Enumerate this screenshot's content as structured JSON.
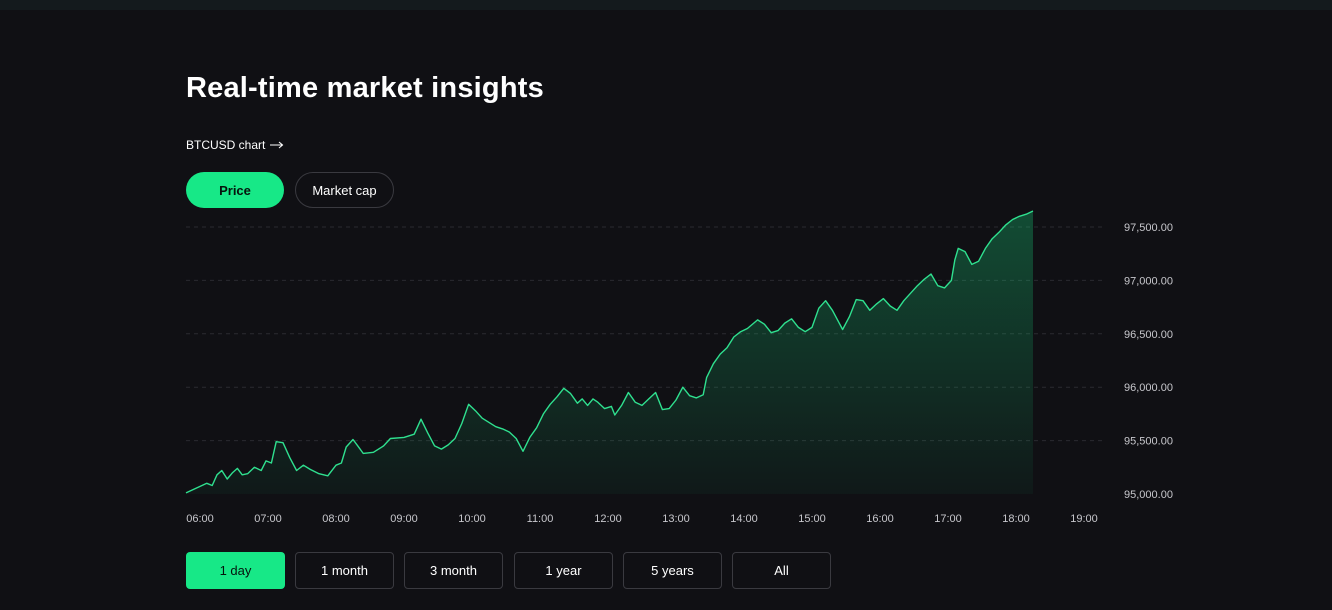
{
  "header": {
    "title": "Real-time market insights",
    "chart_link": "BTCUSD chart"
  },
  "toggle": {
    "price": "Price",
    "market_cap": "Market cap",
    "active": "price"
  },
  "ranges": {
    "items": [
      "1 day",
      "1 month",
      "3 month",
      "1 year",
      "5 years",
      "All"
    ],
    "active": "1 day"
  },
  "colors": {
    "accent": "#17e887",
    "background": "#101014",
    "line": "#2fe08f",
    "grid": "#2a2a30"
  },
  "chart_data": {
    "type": "area",
    "title": "",
    "xlabel": "",
    "ylabel": "",
    "x_ticks": [
      "06:00",
      "07:00",
      "08:00",
      "09:00",
      "10:00",
      "11:00",
      "12:00",
      "13:00",
      "14:00",
      "15:00",
      "16:00",
      "17:00",
      "18:00",
      "19:00"
    ],
    "y_ticks": [
      "95,000.00",
      "95,500.00",
      "96,000.00",
      "96,500.00",
      "97,000.00",
      "97,500.00"
    ],
    "ylim": [
      95000,
      97500
    ],
    "xlim_hours": [
      6.0,
      19.3
    ],
    "grid": "horizontal-dashed",
    "y_axis_side": "right",
    "series": [
      {
        "points": [
          [
            6.0,
            95010
          ],
          [
            6.1,
            95100
          ],
          [
            6.18,
            95080
          ],
          [
            6.25,
            95180
          ],
          [
            6.32,
            95220
          ],
          [
            6.4,
            95140
          ],
          [
            6.48,
            95200
          ],
          [
            6.55,
            95240
          ],
          [
            6.62,
            95180
          ],
          [
            6.7,
            95190
          ],
          [
            6.8,
            95250
          ],
          [
            6.9,
            95220
          ],
          [
            6.97,
            95310
          ],
          [
            7.05,
            95290
          ],
          [
            7.12,
            95490
          ],
          [
            7.22,
            95480
          ],
          [
            7.32,
            95340
          ],
          [
            7.42,
            95220
          ],
          [
            7.52,
            95270
          ],
          [
            7.62,
            95230
          ],
          [
            7.75,
            95190
          ],
          [
            7.88,
            95170
          ],
          [
            8.0,
            95270
          ],
          [
            8.08,
            95290
          ],
          [
            8.15,
            95440
          ],
          [
            8.25,
            95510
          ],
          [
            8.32,
            95450
          ],
          [
            8.4,
            95380
          ],
          [
            8.55,
            95390
          ],
          [
            8.7,
            95450
          ],
          [
            8.8,
            95520
          ],
          [
            9.0,
            95530
          ],
          [
            9.15,
            95560
          ],
          [
            9.25,
            95700
          ],
          [
            9.35,
            95570
          ],
          [
            9.45,
            95450
          ],
          [
            9.55,
            95420
          ],
          [
            9.65,
            95460
          ],
          [
            9.75,
            95520
          ],
          [
            9.85,
            95660
          ],
          [
            9.95,
            95840
          ],
          [
            10.05,
            95780
          ],
          [
            10.15,
            95710
          ],
          [
            10.35,
            95630
          ],
          [
            10.45,
            95610
          ],
          [
            10.55,
            95580
          ],
          [
            10.65,
            95520
          ],
          [
            10.75,
            95400
          ],
          [
            10.85,
            95530
          ],
          [
            10.95,
            95620
          ],
          [
            11.05,
            95750
          ],
          [
            11.15,
            95840
          ],
          [
            11.25,
            95910
          ],
          [
            11.35,
            95990
          ],
          [
            11.45,
            95940
          ],
          [
            11.55,
            95850
          ],
          [
            11.62,
            95890
          ],
          [
            11.7,
            95830
          ],
          [
            11.78,
            95890
          ],
          [
            11.85,
            95860
          ],
          [
            11.95,
            95800
          ],
          [
            12.05,
            95820
          ],
          [
            12.1,
            95740
          ],
          [
            12.2,
            95830
          ],
          [
            12.3,
            95950
          ],
          [
            12.4,
            95860
          ],
          [
            12.5,
            95830
          ],
          [
            12.6,
            95890
          ],
          [
            12.7,
            95950
          ],
          [
            12.8,
            95790
          ],
          [
            12.9,
            95800
          ],
          [
            13.0,
            95880
          ],
          [
            13.1,
            96000
          ],
          [
            13.2,
            95920
          ],
          [
            13.3,
            95900
          ],
          [
            13.4,
            95930
          ],
          [
            13.45,
            96090
          ],
          [
            13.55,
            96220
          ],
          [
            13.65,
            96310
          ],
          [
            13.75,
            96370
          ],
          [
            13.85,
            96470
          ],
          [
            13.95,
            96520
          ],
          [
            14.05,
            96550
          ],
          [
            14.2,
            96630
          ],
          [
            14.3,
            96590
          ],
          [
            14.4,
            96510
          ],
          [
            14.5,
            96530
          ],
          [
            14.6,
            96600
          ],
          [
            14.7,
            96640
          ],
          [
            14.8,
            96560
          ],
          [
            14.9,
            96520
          ],
          [
            15.0,
            96560
          ],
          [
            15.1,
            96740
          ],
          [
            15.2,
            96810
          ],
          [
            15.3,
            96720
          ],
          [
            15.4,
            96600
          ],
          [
            15.45,
            96540
          ],
          [
            15.55,
            96660
          ],
          [
            15.65,
            96820
          ],
          [
            15.75,
            96810
          ],
          [
            15.85,
            96720
          ],
          [
            15.95,
            96780
          ],
          [
            16.05,
            96830
          ],
          [
            16.15,
            96760
          ],
          [
            16.25,
            96720
          ],
          [
            16.35,
            96810
          ],
          [
            16.45,
            96880
          ],
          [
            16.55,
            96950
          ],
          [
            16.65,
            97010
          ],
          [
            16.75,
            97060
          ],
          [
            16.85,
            96950
          ],
          [
            16.95,
            96930
          ],
          [
            17.05,
            97000
          ],
          [
            17.1,
            97190
          ],
          [
            17.15,
            97300
          ],
          [
            17.25,
            97270
          ],
          [
            17.35,
            97150
          ],
          [
            17.45,
            97180
          ],
          [
            17.55,
            97300
          ],
          [
            17.65,
            97390
          ],
          [
            17.75,
            97450
          ],
          [
            17.85,
            97520
          ],
          [
            17.95,
            97570
          ],
          [
            18.05,
            97600
          ],
          [
            18.15,
            97620
          ],
          [
            18.25,
            97650
          ]
        ]
      }
    ]
  }
}
